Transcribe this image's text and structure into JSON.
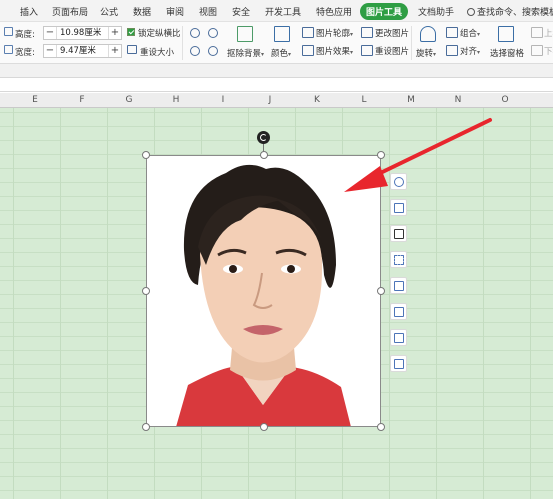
{
  "menubar": {
    "tabs": [
      "插入",
      "页面布局",
      "公式",
      "数据",
      "审阅",
      "视图",
      "安全",
      "开发工具",
      "特色应用",
      "图片工具",
      "文档助手"
    ],
    "active_tab": "图片工具",
    "search_text": "查找命令、搜索模板"
  },
  "ribbon": {
    "height_label": "高度:",
    "height_value": "10.98厘米",
    "width_label": "宽度:",
    "width_value": "9.47厘米",
    "minus": "−",
    "plus": "+",
    "lock_ratio": "锁定纵横比",
    "reset_size": "重设大小",
    "remove_bg": "抠除背景",
    "color": "颜色",
    "pic_outline": "图片轮廓",
    "pic_effect": "图片效果",
    "change_pic": "更改图片",
    "reset_pic": "重设图片",
    "rotate": "旋转",
    "group": "组合",
    "align": "对齐",
    "selection_pane": "选择窗格",
    "move_up": "上移",
    "move_down": "下移",
    "caret": "▾"
  },
  "columns": [
    "E",
    "F",
    "G",
    "H",
    "I",
    "J",
    "K",
    "L",
    "M",
    "N",
    "O"
  ],
  "colors": {
    "accent": "#2f9e44",
    "sheet_bg": "#d6ebd4",
    "arrow": "#e8262d"
  }
}
